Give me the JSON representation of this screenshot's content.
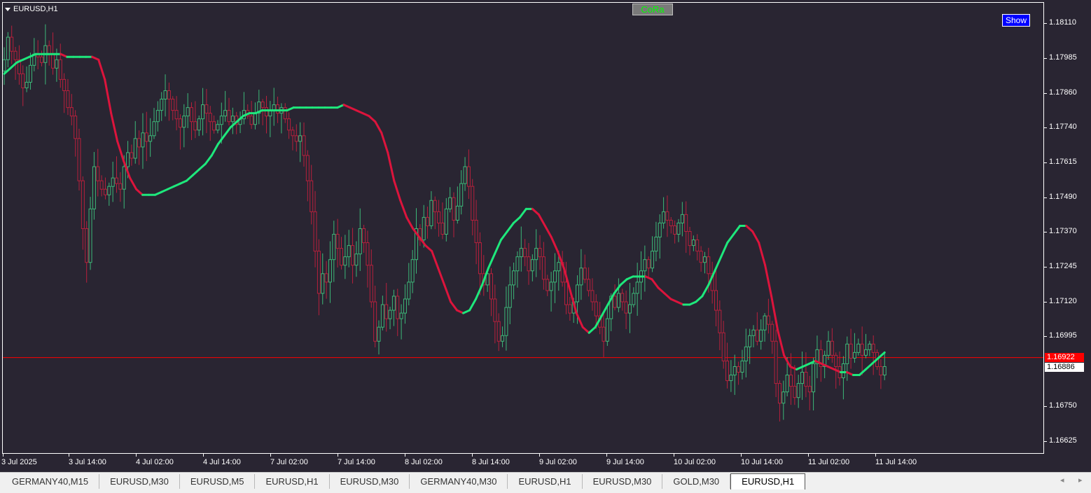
{
  "window": {
    "symbol_title": "EURUSD,H1"
  },
  "indicator": {
    "label": "CoRa",
    "show_button": "Show"
  },
  "colors": {
    "background": "#292532",
    "bull_candle": "#3cb878",
    "bear_candle": "#b8203c",
    "line_up": "#1ee87c",
    "line_down": "#dc143c",
    "bid_line": "#ff0000"
  },
  "price_axis": {
    "labels": [
      "1.18110",
      "1.17985",
      "1.17860",
      "1.17740",
      "1.17615",
      "1.17490",
      "1.17370",
      "1.17245",
      "1.17120",
      "1.16995",
      "1.16750",
      "1.16625"
    ],
    "bid_tag": "1.16922",
    "ask_tag": "1.16886"
  },
  "time_axis": {
    "labels": [
      "3 Jul 2025",
      "3 Jul 14:00",
      "4 Jul 02:00",
      "4 Jul 14:00",
      "7 Jul 02:00",
      "7 Jul 14:00",
      "8 Jul 02:00",
      "8 Jul 14:00",
      "9 Jul 02:00",
      "9 Jul 14:00",
      "10 Jul 02:00",
      "10 Jul 14:00",
      "11 Jul 02:00",
      "11 Jul 14:00"
    ]
  },
  "chart_data": {
    "type": "candlestick",
    "ylim": [
      1.166,
      1.1818
    ],
    "bid": 1.16922,
    "closes": [
      1.1798,
      1.1806,
      1.1801,
      1.1798,
      1.1793,
      1.1788,
      1.179,
      1.1796,
      1.18,
      1.1799,
      1.1797,
      1.1803,
      1.18,
      1.1795,
      1.1798,
      1.1791,
      1.1787,
      1.1781,
      1.1778,
      1.177,
      1.1755,
      1.1738,
      1.1726,
      1.1745,
      1.176,
      1.1755,
      1.1752,
      1.175,
      1.1753,
      1.1756,
      1.1754,
      1.1752,
      1.176,
      1.1765,
      1.1763,
      1.177,
      1.1767,
      1.1772,
      1.1769,
      1.1771,
      1.1776,
      1.178,
      1.1784,
      1.1787,
      1.1784,
      1.178,
      1.1777,
      1.1774,
      1.1778,
      1.1781,
      1.1776,
      1.1773,
      1.1777,
      1.1782,
      1.1779,
      1.1776,
      1.1773,
      1.1775,
      1.1778,
      1.178,
      1.1776,
      1.1778,
      1.1775,
      1.1777,
      1.178,
      1.1778,
      1.1775,
      1.1779,
      1.1783,
      1.1781,
      1.1778,
      1.178,
      1.1782,
      1.1779,
      1.1781,
      1.1777,
      1.1773,
      1.1771,
      1.1769,
      1.1771,
      1.1764,
      1.1755,
      1.1744,
      1.173,
      1.1715,
      1.1722,
      1.1719,
      1.1727,
      1.1736,
      1.1731,
      1.1725,
      1.1728,
      1.1732,
      1.1725,
      1.1729,
      1.1738,
      1.1733,
      1.1725,
      1.1712,
      1.1698,
      1.1703,
      1.1711,
      1.1706,
      1.1709,
      1.1714,
      1.1706,
      1.1708,
      1.1713,
      1.1719,
      1.1727,
      1.1738,
      1.1734,
      1.1742,
      1.1739,
      1.1748,
      1.1744,
      1.174,
      1.1736,
      1.1745,
      1.1749,
      1.1741,
      1.1746,
      1.1754,
      1.176,
      1.1753,
      1.1741,
      1.1733,
      1.1722,
      1.1718,
      1.1722,
      1.1713,
      1.1705,
      1.1698,
      1.17,
      1.171,
      1.1718,
      1.1723,
      1.1728,
      1.1731,
      1.1728,
      1.1723,
      1.1727,
      1.1731,
      1.1728,
      1.172,
      1.1716,
      1.1719,
      1.1723,
      1.1726,
      1.1719,
      1.1711,
      1.1708,
      1.1712,
      1.1718,
      1.1724,
      1.172,
      1.1716,
      1.1712,
      1.1707,
      1.1703,
      1.1698,
      1.1706,
      1.1714,
      1.171,
      1.1715,
      1.1712,
      1.1708,
      1.1711,
      1.1715,
      1.1719,
      1.1723,
      1.1727,
      1.1724,
      1.173,
      1.1735,
      1.174,
      1.1744,
      1.1741,
      1.1739,
      1.1736,
      1.174,
      1.1743,
      1.1737,
      1.1732,
      1.1734,
      1.173,
      1.1726,
      1.1728,
      1.1722,
      1.1716,
      1.1709,
      1.1701,
      1.1691,
      1.1684,
      1.1686,
      1.1689,
      1.1687,
      1.1691,
      1.1696,
      1.17,
      1.1702,
      1.1698,
      1.1702,
      1.1707,
      1.1704,
      1.1698,
      1.1683,
      1.1676,
      1.168,
      1.1686,
      1.1682,
      1.1678,
      1.1683,
      1.1687,
      1.1682,
      1.168,
      1.169,
      1.1695,
      1.1689,
      1.1693,
      1.1698,
      1.1693,
      1.1689,
      1.1685,
      1.169,
      1.1697,
      1.1692,
      1.1694,
      1.1697,
      1.1693,
      1.1695,
      1.1697,
      1.1694,
      1.1689,
      1.1686,
      1.1689
    ],
    "indicator_line": [
      1.1793,
      1.1795,
      1.1797,
      1.1798,
      1.1799,
      1.18,
      1.18,
      1.18,
      1.18,
      1.18,
      1.1799,
      1.1799,
      1.1799,
      1.1799,
      1.1799,
      1.1798,
      1.1791,
      1.1779,
      1.1769,
      1.1762,
      1.1756,
      1.1752,
      1.175,
      1.175,
      1.175,
      1.1751,
      1.1752,
      1.1753,
      1.1754,
      1.1755,
      1.1757,
      1.1759,
      1.1761,
      1.1764,
      1.1768,
      1.1771,
      1.1774,
      1.1776,
      1.1778,
      1.1779,
      1.1779,
      1.178,
      1.178,
      1.178,
      1.178,
      1.178,
      1.1781,
      1.1781,
      1.1781,
      1.1781,
      1.1781,
      1.1781,
      1.1781,
      1.1781,
      1.1782,
      1.1781,
      1.178,
      1.1779,
      1.1778,
      1.1776,
      1.1772,
      1.1765,
      1.1755,
      1.1748,
      1.1742,
      1.1738,
      1.1735,
      1.1732,
      1.173,
      1.1724,
      1.1718,
      1.1712,
      1.1709,
      1.1708,
      1.1709,
      1.1713,
      1.1718,
      1.1724,
      1.1729,
      1.1734,
      1.1737,
      1.174,
      1.1742,
      1.1745,
      1.1745,
      1.1743,
      1.1739,
      1.1735,
      1.173,
      1.1724,
      1.1716,
      1.1708,
      1.1703,
      1.1701,
      1.1703,
      1.1707,
      1.1711,
      1.1715,
      1.1718,
      1.172,
      1.1721,
      1.1721,
      1.1721,
      1.172,
      1.1717,
      1.1715,
      1.1713,
      1.1712,
      1.1711,
      1.1711,
      1.1712,
      1.1714,
      1.1718,
      1.1723,
      1.1728,
      1.1733,
      1.1736,
      1.1739,
      1.1739,
      1.1737,
      1.1733,
      1.1725,
      1.1714,
      1.1702,
      1.1693,
      1.1689,
      1.1688,
      1.1689,
      1.169,
      1.1691,
      1.169,
      1.1689,
      1.1688,
      1.1687,
      1.1687,
      1.1686,
      1.1686,
      1.1688,
      1.169,
      1.1692,
      1.1694
    ],
    "series": [
      {
        "name": "CoRa",
        "values": []
      }
    ]
  },
  "tabs": [
    {
      "label": "GERMANY40,M15",
      "active": false
    },
    {
      "label": "EURUSD,M30",
      "active": false
    },
    {
      "label": "EURUSD,M5",
      "active": false
    },
    {
      "label": "EURUSD,H1",
      "active": false
    },
    {
      "label": "EURUSD,M30",
      "active": false
    },
    {
      "label": "GERMANY40,M30",
      "active": false
    },
    {
      "label": "EURUSD,H1",
      "active": false
    },
    {
      "label": "EURUSD,M30",
      "active": false
    },
    {
      "label": "GOLD,M30",
      "active": false
    },
    {
      "label": "EURUSD,H1",
      "active": true
    }
  ],
  "scroll": {
    "left": "◂",
    "right": "▸"
  }
}
